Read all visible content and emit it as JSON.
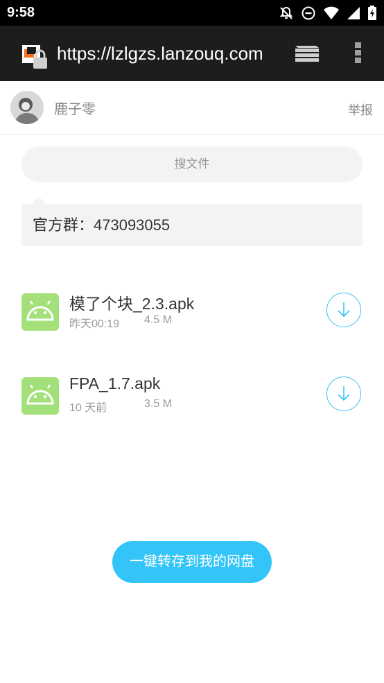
{
  "status_bar": {
    "time": "9:58"
  },
  "browser": {
    "url": "https://lzlgzs.lanzouq.com"
  },
  "header": {
    "owner_name": "鹿子零",
    "report_label": "举报"
  },
  "search": {
    "placeholder": "搜文件"
  },
  "notice": {
    "text": "官方群：473093055"
  },
  "files": [
    {
      "name": "模了个块_2.3.apk",
      "date": "昨天00:19",
      "size": "4.5 M",
      "icon": "android-icon"
    },
    {
      "name": "FPA_1.7.apk",
      "date": "10 天前",
      "size": "3.5 M",
      "icon": "android-icon"
    }
  ],
  "actions": {
    "save_label": "一键转存到我的网盘"
  },
  "colors": {
    "accent": "#33c4f8",
    "file_icon_bg": "#a4e07a"
  }
}
